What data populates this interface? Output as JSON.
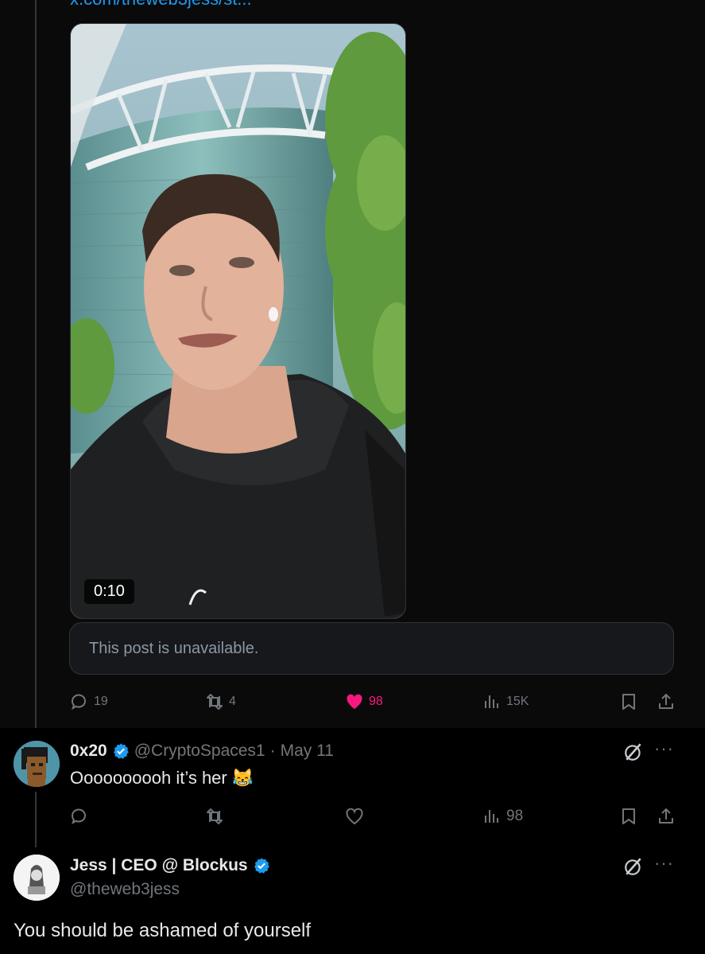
{
  "top_link": "x.com/theweb3jess/st...",
  "video": {
    "duration": "0:10"
  },
  "quoted_unavailable": "This post is unavailable.",
  "main_actions": {
    "replies": "19",
    "reposts": "4",
    "likes": "98",
    "views": "15K"
  },
  "reply": {
    "display_name": "0x20",
    "handle": "@CryptoSpaces1",
    "separator": "·",
    "date": "May 11",
    "text": "Oooooooooh it’s her",
    "emoji": "😹",
    "views": "98"
  },
  "third": {
    "display_name": "Jess | CEO @ Blockus",
    "handle": "@theweb3jess",
    "text": "You should be ashamed of yourself"
  },
  "icons": [
    "reply-icon",
    "repost-icon",
    "heart-icon",
    "views-icon",
    "bookmark-icon",
    "share-icon",
    "verified-icon",
    "grok-icon",
    "more-icon"
  ],
  "colors": {
    "accent": "#1d9bf0",
    "like": "#f91880",
    "muted": "#71767b",
    "verified": "#1d9bf0"
  }
}
